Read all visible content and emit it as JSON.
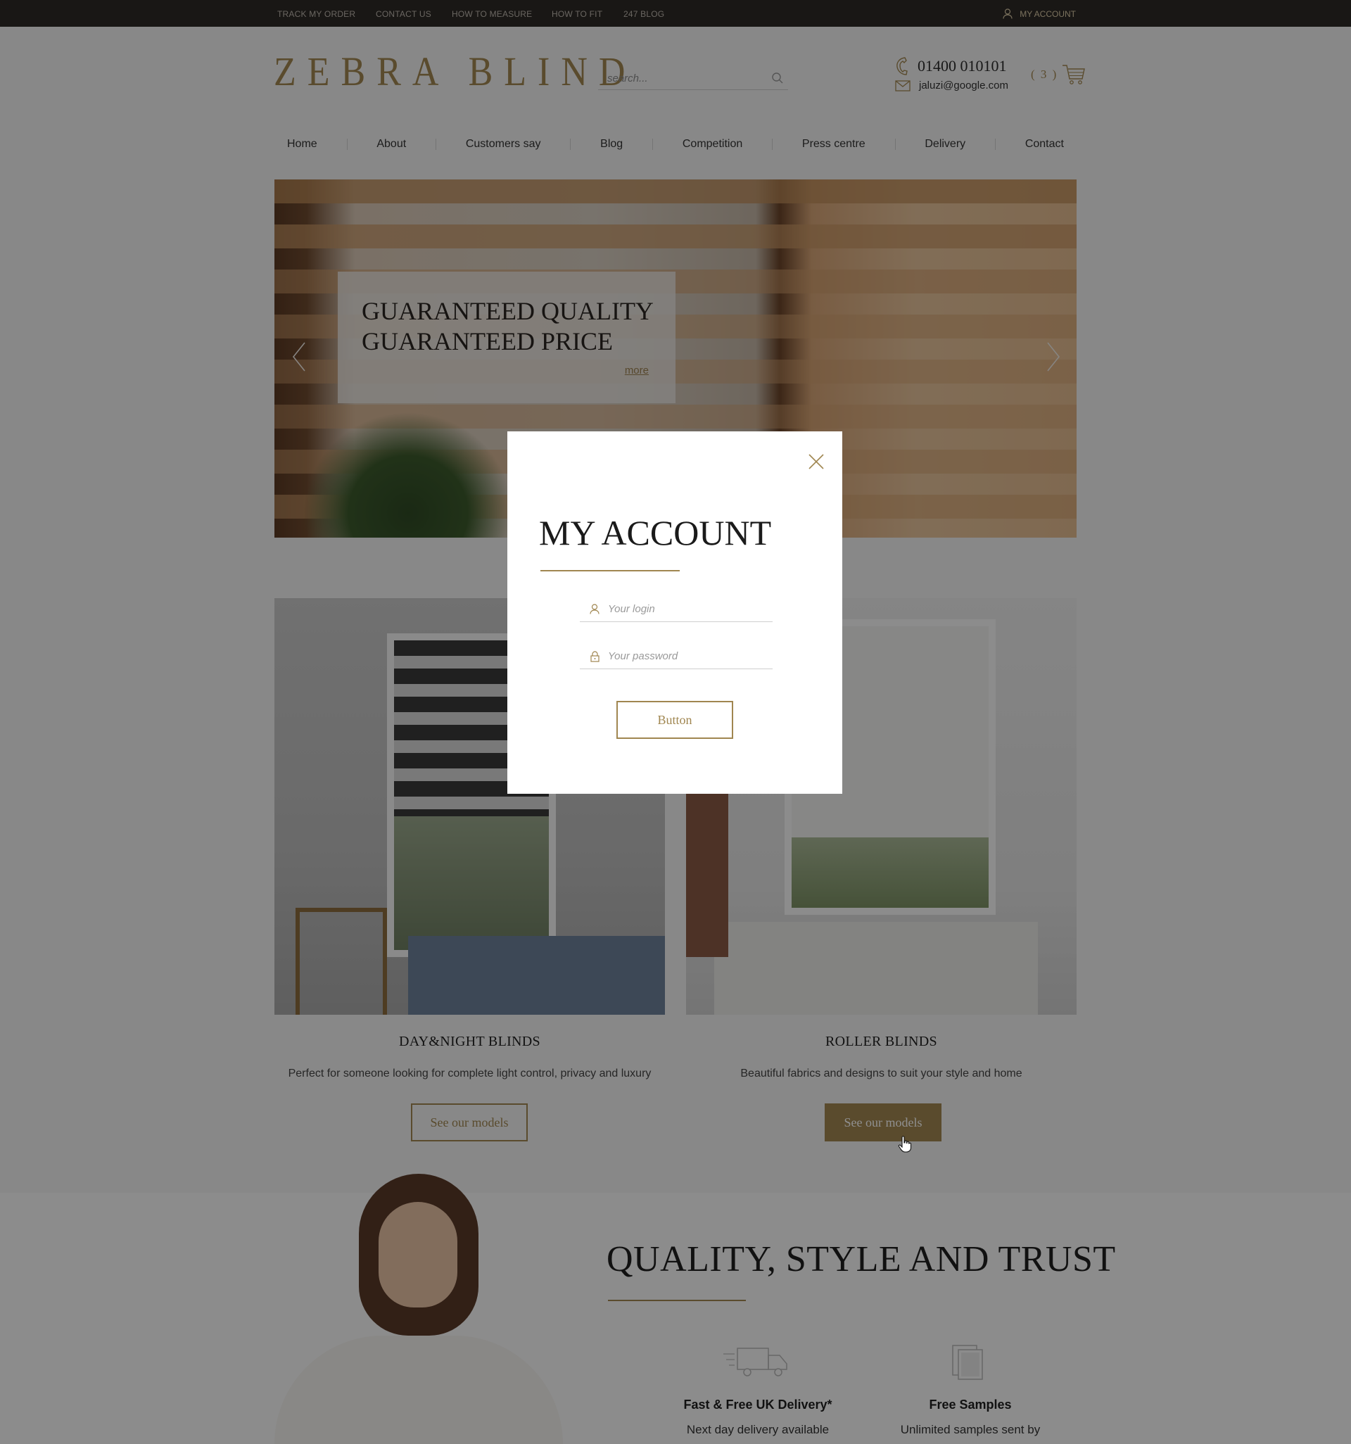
{
  "topbar": {
    "links": [
      "TRACK MY ORDER",
      "CONTACT US",
      "HOW TO MEASURE",
      "HOW TO FIT",
      "247 BLOG"
    ],
    "account": "MY ACCOUNT"
  },
  "header": {
    "logo": "ZEBRA BLIND",
    "search_placeholder": "search...",
    "phone": "01400 010101",
    "email": "jaluzi@google.com",
    "cart_count": "( 3 )"
  },
  "nav": [
    "Home",
    "About",
    "Customers say",
    "Blog",
    "Competition",
    "Press centre",
    "Delivery",
    "Contact"
  ],
  "hero": {
    "line1": "GUARANTEED QUALITY",
    "line2": "GUARANTEED PRICE",
    "more": "more"
  },
  "products": [
    {
      "title": "DAY&NIGHT BLINDS",
      "desc": "Perfect for someone looking for complete light control, privacy and luxury",
      "button": "See our models"
    },
    {
      "title": "ROLLER BLINDS",
      "desc": "Beautiful fabrics and designs to suit your style and home",
      "button": "See our models"
    }
  ],
  "quality": {
    "title": "QUALITY, STYLE AND TRUST",
    "features": [
      {
        "title": "Fast & Free UK Delivery*",
        "desc": "Next day delivery available"
      },
      {
        "title": "Free Samples",
        "desc": "Unlimited samples sent by"
      }
    ]
  },
  "modal": {
    "title": "MY ACCOUNT",
    "login_placeholder": "Your login",
    "password_placeholder": "Your password",
    "button": "Button"
  },
  "colors": {
    "accent": "#a08650",
    "topbar": "#2e2a27",
    "overlay": "rgba(0,0,0,0.44)"
  }
}
